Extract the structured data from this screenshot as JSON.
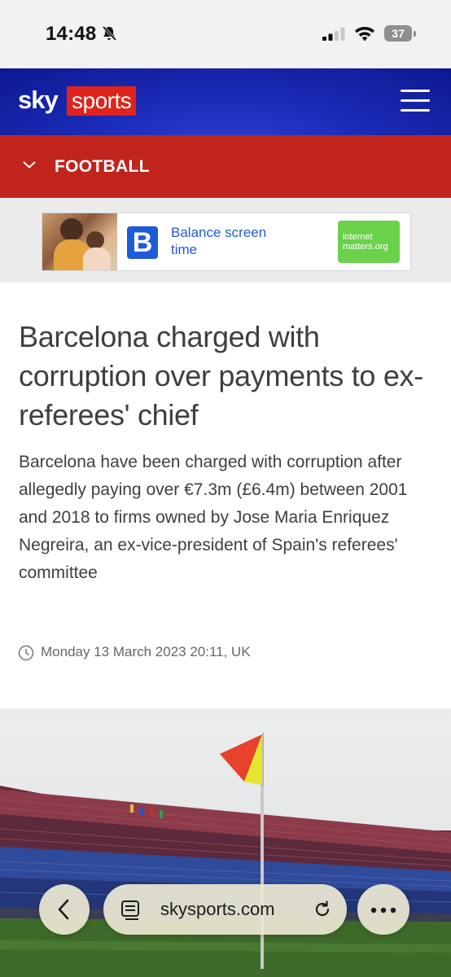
{
  "status_bar": {
    "time": "14:48",
    "battery": "37"
  },
  "header": {
    "logo_sky": "sky",
    "logo_sports": "sports"
  },
  "section": {
    "label": "FOOTBALL"
  },
  "ad": {
    "brand_letter": "B",
    "text": "Balance screen time",
    "partner_logo_text": "internet matters.org"
  },
  "article": {
    "headline": "Barcelona charged with corruption over payments to ex-referees' chief",
    "standfirst": "Barcelona have been charged with corruption after allegedly paying over €7.3m (£6.4m) between 2001 and 2018 to firms owned by Jose Maria Enriquez Negreira, an ex-vice-president of Spain's referees' committee",
    "timestamp": "Monday 13 March 2023 20:11, UK"
  },
  "browser_bar": {
    "url": "skysports.com"
  },
  "colors": {
    "header_blue": "#1b2bb8",
    "section_red": "#c0241c",
    "sports_red": "#e0231b",
    "ad_blue": "#1e5bd6",
    "ad_green": "#6bd14b"
  }
}
